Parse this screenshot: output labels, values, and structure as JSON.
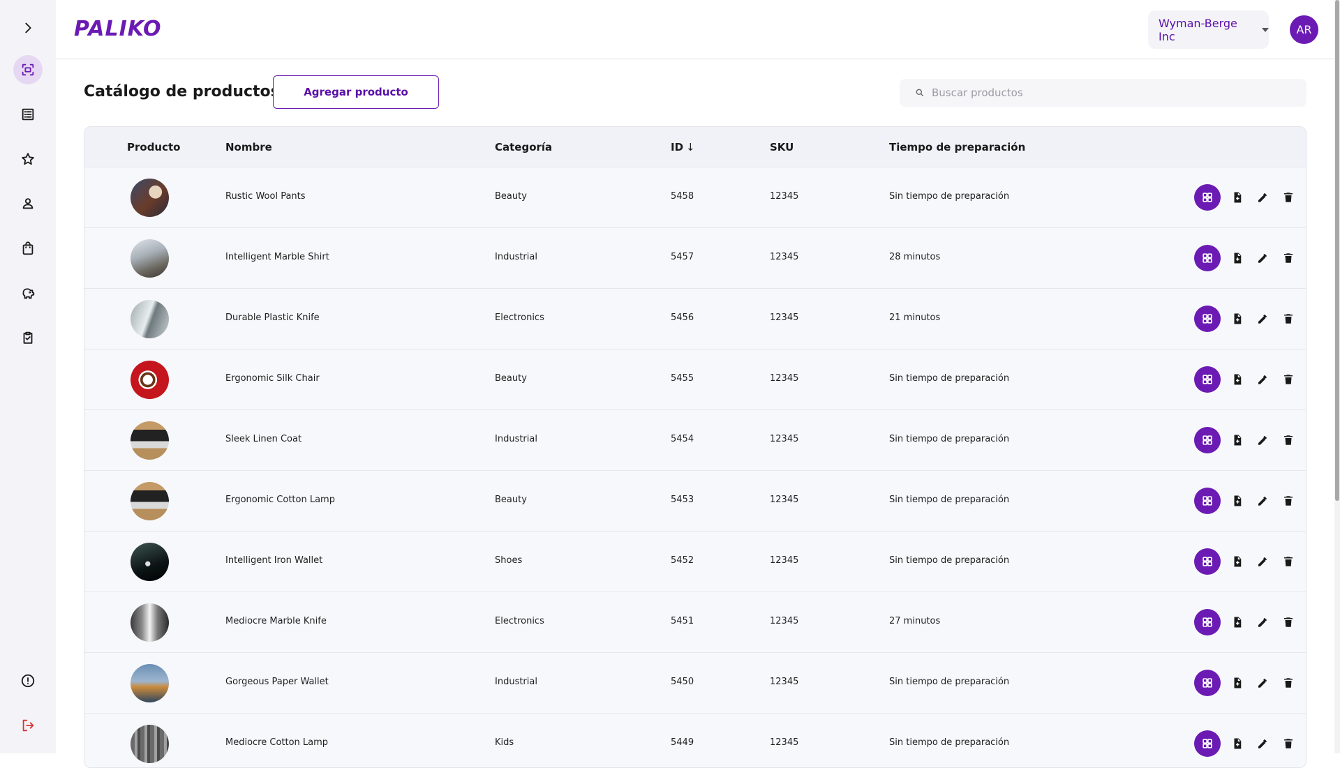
{
  "app": {
    "logo_text": "PALIKO"
  },
  "header": {
    "organization": "Wyman-Berge Inc",
    "avatar_initials": "AR"
  },
  "page": {
    "title": "Catálogo de productos",
    "add_button": "Agregar producto",
    "search_placeholder": "Buscar productos"
  },
  "sidebar": {
    "items": [
      {
        "icon": "scan-icon",
        "active": true
      },
      {
        "icon": "list-icon",
        "active": false
      },
      {
        "icon": "star-icon",
        "active": false
      },
      {
        "icon": "person-icon",
        "active": false
      },
      {
        "icon": "bag-icon",
        "active": false
      },
      {
        "icon": "piggy-bank-icon",
        "active": false
      },
      {
        "icon": "clipboard-check-icon",
        "active": false
      }
    ],
    "bottom": [
      {
        "icon": "info-icon"
      },
      {
        "icon": "logout-icon"
      }
    ]
  },
  "table": {
    "columns": {
      "product": "Producto",
      "name": "Nombre",
      "category": "Categoría",
      "id": "ID",
      "id_sort": "↓",
      "sku": "SKU",
      "prep_time": "Tiempo de preparación"
    },
    "rows": [
      {
        "name": "Rustic Wool Pants",
        "category": "Beauty",
        "id": "5458",
        "sku": "12345",
        "prep": "Sin tiempo de preparación"
      },
      {
        "name": "Intelligent Marble Shirt",
        "category": "Industrial",
        "id": "5457",
        "sku": "12345",
        "prep": "28 minutos"
      },
      {
        "name": "Durable Plastic Knife",
        "category": "Electronics",
        "id": "5456",
        "sku": "12345",
        "prep": "21 minutos"
      },
      {
        "name": "Ergonomic Silk Chair",
        "category": "Beauty",
        "id": "5455",
        "sku": "12345",
        "prep": "Sin tiempo de preparación"
      },
      {
        "name": "Sleek Linen Coat",
        "category": "Industrial",
        "id": "5454",
        "sku": "12345",
        "prep": "Sin tiempo de preparación"
      },
      {
        "name": "Ergonomic Cotton Lamp",
        "category": "Beauty",
        "id": "5453",
        "sku": "12345",
        "prep": "Sin tiempo de preparación"
      },
      {
        "name": "Intelligent Iron Wallet",
        "category": "Shoes",
        "id": "5452",
        "sku": "12345",
        "prep": "Sin tiempo de preparación"
      },
      {
        "name": "Mediocre Marble Knife",
        "category": "Electronics",
        "id": "5451",
        "sku": "12345",
        "prep": "27 minutos"
      },
      {
        "name": "Gorgeous Paper Wallet",
        "category": "Industrial",
        "id": "5450",
        "sku": "12345",
        "prep": "Sin tiempo de preparación"
      },
      {
        "name": "Mediocre Cotton Lamp",
        "category": "Kids",
        "id": "5449",
        "sku": "12345",
        "prep": "Sin tiempo de preparación"
      }
    ]
  },
  "colors": {
    "brand": "#6b1bb3",
    "brand_text": "#5b0fa8",
    "logout": "#d63535"
  }
}
